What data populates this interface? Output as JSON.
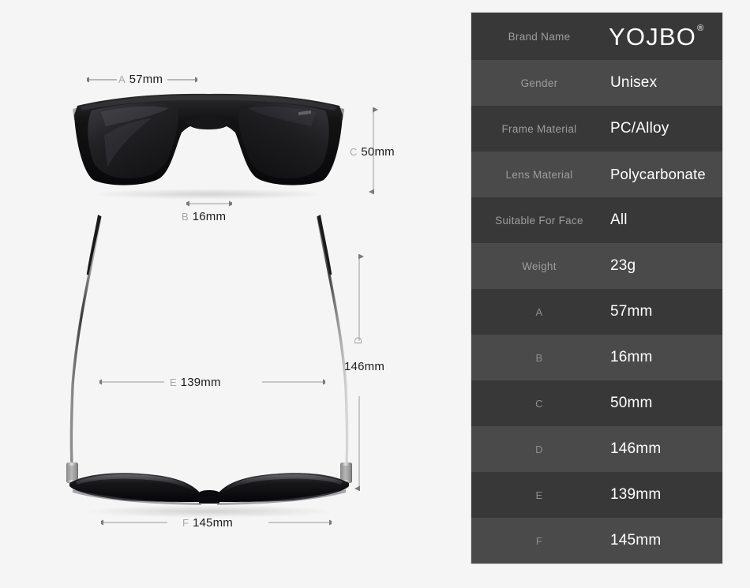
{
  "product": {
    "diagram_measurements": [
      {
        "letter": "A",
        "value": "57mm",
        "axis": "horizontal",
        "view": "front"
      },
      {
        "letter": "B",
        "value": "16mm",
        "axis": "horizontal",
        "view": "front-bridge"
      },
      {
        "letter": "C",
        "value": "50mm",
        "axis": "vertical",
        "view": "front"
      },
      {
        "letter": "D",
        "value": "146mm",
        "axis": "vertical",
        "view": "top"
      },
      {
        "letter": "E",
        "value": "139mm",
        "axis": "horizontal",
        "view": "top"
      },
      {
        "letter": "F",
        "value": "145mm",
        "axis": "horizontal",
        "view": "bottom"
      }
    ],
    "diagram_labels": {
      "a_letter": "A",
      "a_value": "57mm",
      "b_letter": "B",
      "b_value": "16mm",
      "c_letter": "C",
      "c_value": "50mm",
      "d_letter": "D",
      "d_value": "146mm",
      "e_letter": "E",
      "e_value": "139mm",
      "f_letter": "F",
      "f_value": "145mm"
    }
  },
  "spec_table": {
    "brand_logo_text": "YOJBO",
    "brand_logo_registered": "®",
    "rows": [
      {
        "key": "Brand Name",
        "value": "YOJBO"
      },
      {
        "key": "Gender",
        "value": "Unisex"
      },
      {
        "key": "Frame Material",
        "value": "PC/Alloy"
      },
      {
        "key": "Lens Material",
        "value": "Polycarbonate"
      },
      {
        "key": "Suitable For Face",
        "value": "All"
      },
      {
        "key": "Weight",
        "value": "23g"
      },
      {
        "key": "A",
        "value": "57mm"
      },
      {
        "key": "B",
        "value": "16mm"
      },
      {
        "key": "C",
        "value": "50mm"
      },
      {
        "key": "D",
        "value": "146mm"
      },
      {
        "key": "E",
        "value": "139mm"
      },
      {
        "key": "F",
        "value": "145mm"
      }
    ]
  },
  "colors": {
    "page_background": "#f5f5f5",
    "row_dark": "#383838",
    "row_light": "#4a4a4a",
    "value_text": "#ffffff",
    "key_text": "#9d9d9d",
    "dimension_text": "#1c1c1c",
    "dimension_letter": "#a8a8a8",
    "frame_black": "#111111",
    "lens_black": "#1a1a1a"
  }
}
